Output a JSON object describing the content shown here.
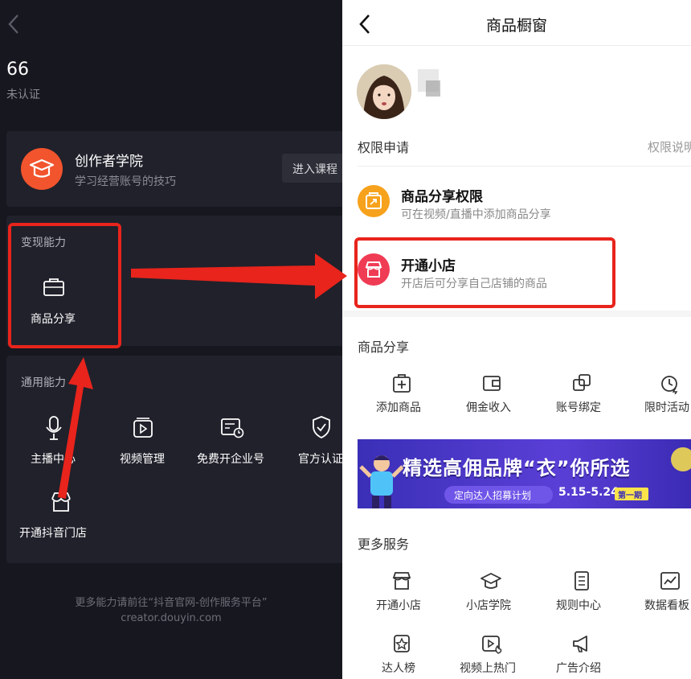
{
  "left": {
    "back_icon": "chevron-left-icon",
    "count": "66",
    "verify_status": "未认证",
    "academy": {
      "title": "创作者学院",
      "subtitle": "学习经营账号的技巧",
      "button": "进入课程",
      "icon": "graduation-cap-icon"
    },
    "monetize": {
      "heading": "变现能力",
      "items": [
        {
          "label": "商品分享",
          "icon": "briefcase-icon"
        }
      ]
    },
    "general": {
      "heading": "通用能力",
      "items": [
        {
          "label": "主播中心",
          "icon": "microphone-icon"
        },
        {
          "label": "视频管理",
          "icon": "video-icon"
        },
        {
          "label": "免费开企业号",
          "icon": "id-card-icon"
        },
        {
          "label": "官方认证",
          "icon": "shield-check-icon"
        },
        {
          "label": "开通抖音门店",
          "icon": "store-icon"
        }
      ]
    },
    "footer_line1": "更多能力请前往“抖音官网-创作服务平台”",
    "footer_line2": "creator.douyin.com"
  },
  "right": {
    "title": "商品橱窗",
    "back_icon": "chevron-left-icon",
    "permission": {
      "heading": "权限申请",
      "link": "权限说明"
    },
    "perm_items": [
      {
        "title": "商品分享权限",
        "desc": "可在视频/直播中添加商品分享",
        "icon": "share-bag-icon"
      },
      {
        "title": "开通小店",
        "desc": "开店后可分享自己店铺的商品",
        "icon": "shop-icon"
      }
    ],
    "share": {
      "heading": "商品分享",
      "items": [
        {
          "label": "添加商品",
          "icon": "add-goods-icon"
        },
        {
          "label": "佣金收入",
          "icon": "wallet-icon"
        },
        {
          "label": "账号绑定",
          "icon": "link-icon"
        },
        {
          "label": "限时活动",
          "icon": "timer-icon"
        }
      ]
    },
    "banner": {
      "headline": "精选高佣品牌“衣”你所选",
      "sub": "定向达人招募计划",
      "date": "5.15-5.24",
      "tag": "第一期"
    },
    "more": {
      "heading": "更多服务",
      "items": [
        {
          "label": "开通小店",
          "icon": "shop-icon"
        },
        {
          "label": "小店学院",
          "icon": "graduation-cap-icon"
        },
        {
          "label": "规则中心",
          "icon": "document-icon"
        },
        {
          "label": "数据看板",
          "icon": "chart-icon"
        },
        {
          "label": "达人榜",
          "icon": "star-badge-icon"
        },
        {
          "label": "视频上热门",
          "icon": "video-fire-icon"
        },
        {
          "label": "广告介绍",
          "icon": "megaphone-icon"
        }
      ]
    }
  },
  "colors": {
    "left_bg": "#16171f",
    "card_bg": "#20212b",
    "accent_orange": "#f2542d",
    "highlight_red": "#e8241c",
    "banner_bg": "#3b2bb4"
  }
}
